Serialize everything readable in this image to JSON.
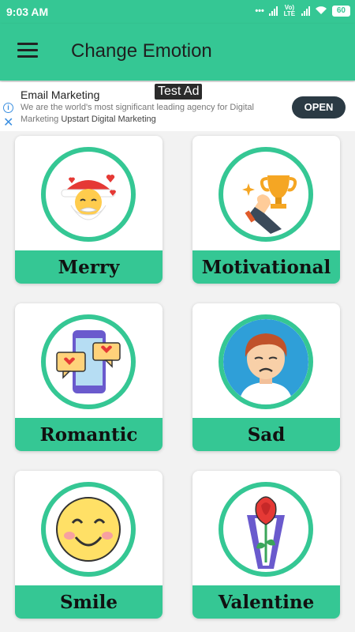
{
  "status": {
    "time": "9:03 AM",
    "carrier_label": "Vo) LTE",
    "battery": "60"
  },
  "appbar": {
    "title": "Change Emotion"
  },
  "ad": {
    "badge": "Test Ad",
    "title": "Email Marketing",
    "text": "We are the world's most significant leading agency for Digital Marketing",
    "advertiser": "Upstart Digital Marketing",
    "cta": "OPEN"
  },
  "emotions": [
    {
      "label": "Merry",
      "icon": "santa-icon"
    },
    {
      "label": "Motivational",
      "icon": "trophy-icon"
    },
    {
      "label": "Romantic",
      "icon": "phone-chat-hearts-icon"
    },
    {
      "label": "Sad",
      "icon": "sad-boy-icon"
    },
    {
      "label": "Smile",
      "icon": "smiley-icon"
    },
    {
      "label": "Valentine",
      "icon": "rose-bouquet-icon"
    }
  ],
  "colors": {
    "accent": "#35c794",
    "ad_button": "#2b3a44"
  }
}
